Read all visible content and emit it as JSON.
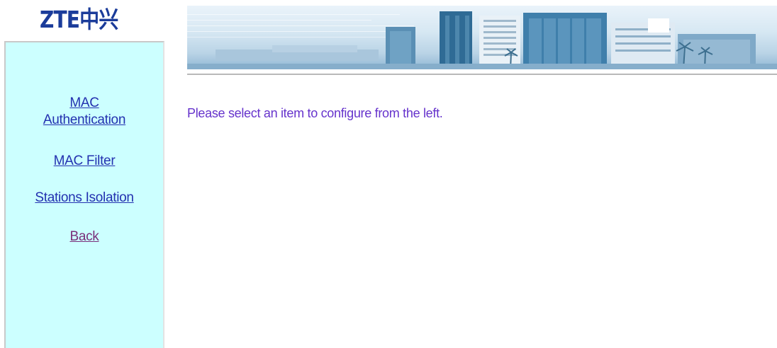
{
  "brand": {
    "logo_text": "ZTE中兴"
  },
  "nav": {
    "items": [
      {
        "label": "MAC Authentication"
      },
      {
        "label": "MAC Filter"
      },
      {
        "label": "Stations Isolation"
      },
      {
        "label": "Back"
      }
    ]
  },
  "main": {
    "message": "Please select an item to configure from the left."
  },
  "colors": {
    "sidebar_bg": "#ccffff",
    "link": "#2331b0",
    "visited_link": "#7a2f7a",
    "message": "#6633cc",
    "logo": "#1b3c9a"
  },
  "icons": {
    "banner": "building-banner-image"
  }
}
